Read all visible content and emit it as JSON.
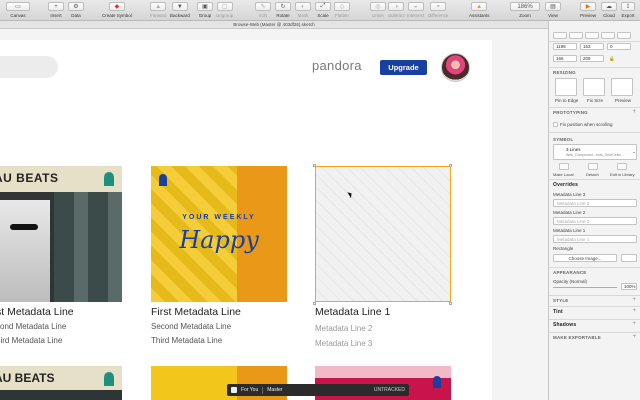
{
  "toolbar": {
    "canvas": "Canvas",
    "insert": "Insert",
    "data": "Data",
    "create_symbol": "Create Symbol",
    "forward": "Forward",
    "backward": "Backward",
    "group": "Group",
    "ungroup": "Ungroup",
    "edit": "Edit",
    "rotate": "Rotate",
    "mask": "Mask",
    "scale": "Scale",
    "flatten": "Flatten",
    "union": "Union",
    "subtract": "Subtract",
    "intersect": "Intersect",
    "difference": "Difference",
    "assistants": "Assistants",
    "zoom": "Zoom",
    "zoom_value": "186%",
    "view": "View",
    "preview": "Preview",
    "cloud": "Cloud",
    "export": "Export"
  },
  "document_title": "Browse-Web (Master @ 403df26).sketch",
  "page": {
    "logo": "pandora",
    "upgrade": "Upgrade",
    "cards": [
      {
        "art_text": "AU BEATS",
        "line1": "st Metadata Line",
        "line2": "cond Metadata Line",
        "line3": "hird Metadata Line"
      },
      {
        "art_small": "YOUR WEEKLY",
        "art_big": "Happy",
        "line1": "First Metadata Line",
        "line2": "Second Metadata Line",
        "line3": "Third Metadata Line"
      },
      {
        "line1": "Metadata Line 1",
        "line2": "Metadata Line 2",
        "line3": "Metadata Line 3"
      }
    ],
    "bottom_art_text": "AU BEATS"
  },
  "library_bar": {
    "item1": "For You",
    "item2": "Master",
    "status": "UNTRACKED"
  },
  "inspector": {
    "x": "1198",
    "y": "153",
    "rotation": "0",
    "w": "166",
    "h": "209",
    "resizing": "RESIZING",
    "pin_to_edge": "Pin to Edge",
    "fix_size": "Fix Size",
    "preview": "Preview",
    "prototyping": "PROTOTYPING",
    "fix_position": "Fix position when scrolling",
    "symbol": "SYMBOL",
    "symbol_name": "3 Lines",
    "symbol_path": "Web_Component...ents_Grid/Cells/...",
    "make_local": "Make Local",
    "detach": "Detach",
    "edit_in_library": "Edit in Library",
    "overrides": "Overrides",
    "ml3_label": "Metadata Line 3",
    "ml3_placeholder": "Metadata Line 3",
    "ml2_label": "Metadata Line 2",
    "ml2_placeholder": "Metadata Line 2",
    "ml1_label": "Metadata Line 1",
    "ml1_placeholder": "Metadata Line 1",
    "rectangle": "Rectangle",
    "choose_image": "Choose Image...",
    "appearance": "APPEARANCE",
    "opacity_label": "Opacity (Normal)",
    "opacity_value": "100%",
    "style": "STYLE",
    "tint": "Tint",
    "shadows": "Shadows",
    "make_exportable": "MAKE EXPORTABLE"
  },
  "colors": {
    "accent_blue": "#1a3fa3",
    "selection_orange": "#f3a61a"
  }
}
